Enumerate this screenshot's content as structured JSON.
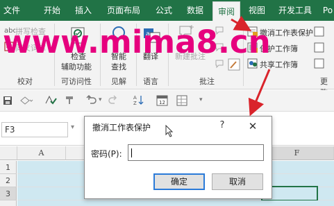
{
  "ribbon": {
    "tabs": [
      "文件",
      "开始",
      "插入",
      "页面布局",
      "公式",
      "数据",
      "审阅",
      "视图",
      "开发工具",
      "Po"
    ],
    "active_tab": "审阅",
    "groups": {
      "proofing": {
        "label": "校对",
        "spell_check": "拼写检查",
        "thesaurus": "同义词库"
      },
      "accessibility": {
        "label": "可访问性",
        "check_line1": "检查",
        "check_line2": "辅助功能"
      },
      "insights": {
        "label": "见解",
        "smart_line1": "智能",
        "smart_line2": "查找"
      },
      "language": {
        "label": "语言",
        "translate": "翻译"
      },
      "comments": {
        "label": "批注",
        "new_comment": "新建批注"
      },
      "changes": {
        "label": "更改",
        "unprotect_sheet": "撤消工作表保护",
        "protect_workbook": "保护工作簿",
        "share_workbook": "共享工作簿"
      }
    }
  },
  "watermark": "www.mima8.cn",
  "qat": {
    "undo_dropdown": "▾",
    "customize": "▾"
  },
  "formula_bar": {
    "name_box": "F3"
  },
  "grid": {
    "columns": [
      "A",
      "F"
    ],
    "rows": [
      "1",
      "2",
      "3"
    ]
  },
  "dialog": {
    "title": "撤消工作表保护",
    "help": "?",
    "close": "✕",
    "password_label": "密码(P):",
    "password_value": "",
    "ok_label": "确定",
    "cancel_label": "取消"
  },
  "colors": {
    "excel_green": "#217346",
    "watermark": "#e6007e",
    "annotation_arrow": "#d9242b",
    "default_button_border": "#2a7ad8"
  }
}
